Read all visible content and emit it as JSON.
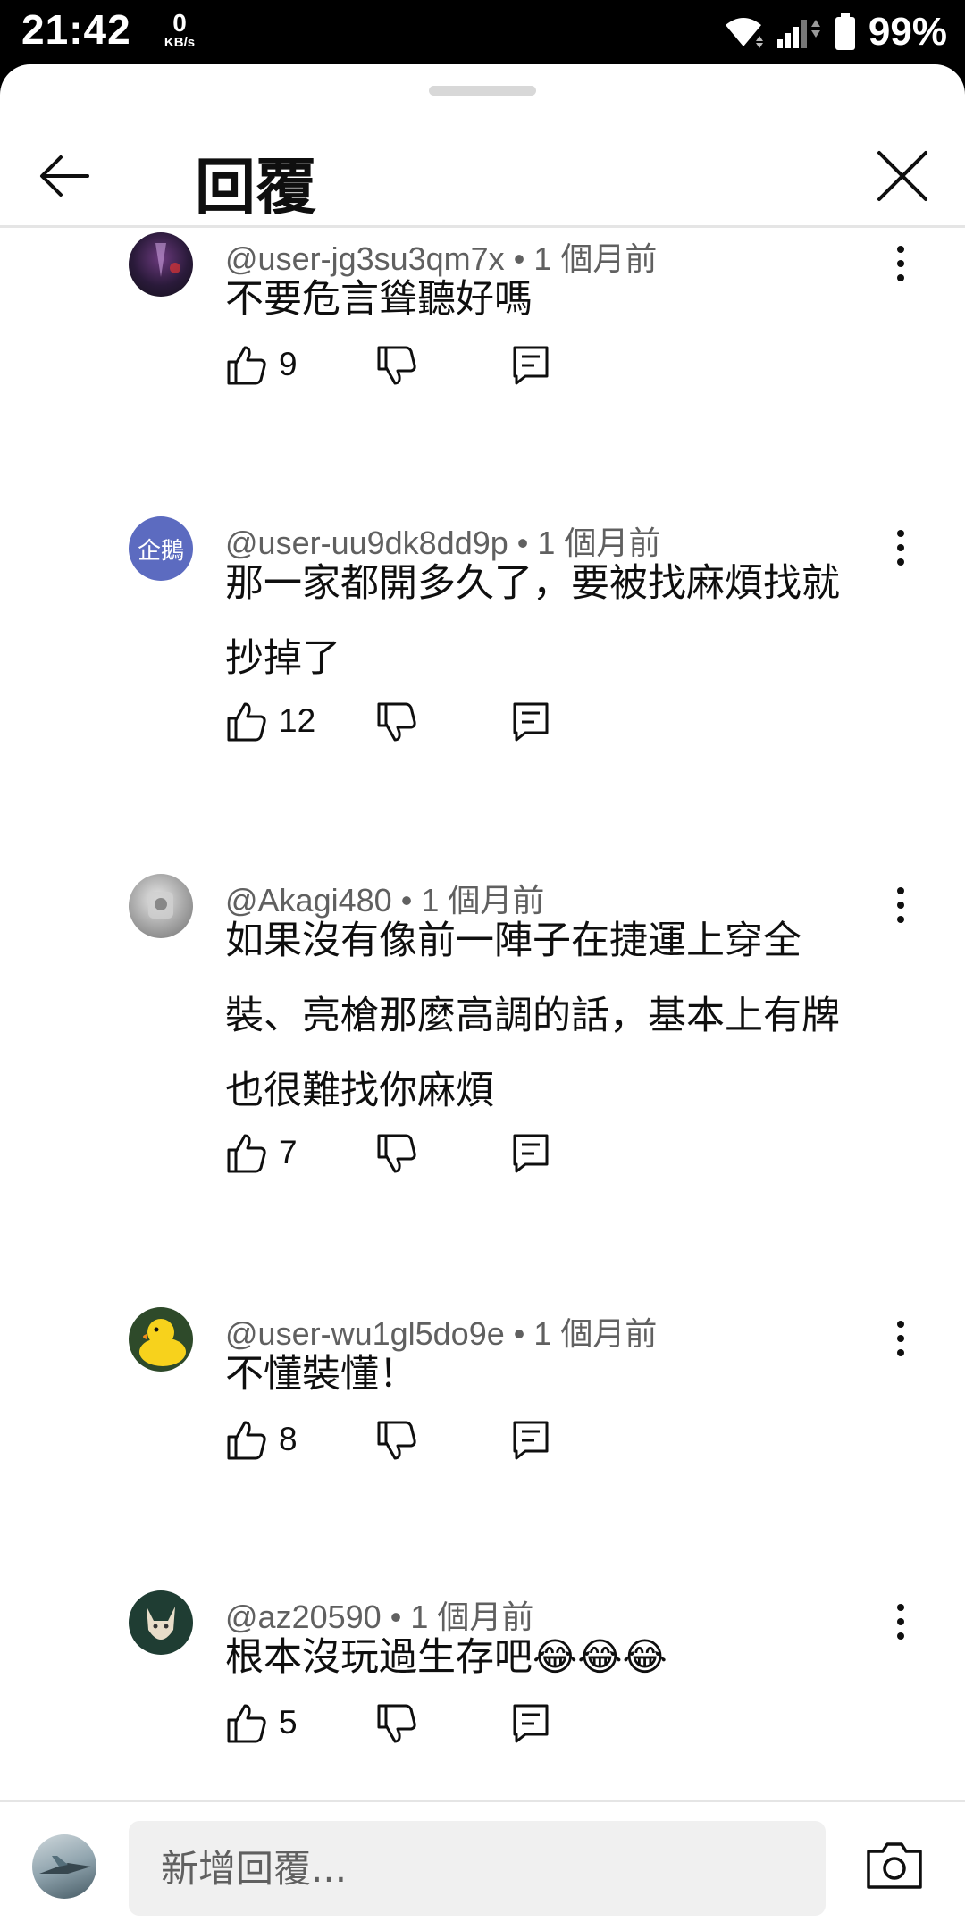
{
  "status_bar": {
    "time": "21:42",
    "net_speed_value": "0",
    "net_speed_unit": "KB/s",
    "battery": "99%"
  },
  "header": {
    "title": "回覆"
  },
  "comments": [
    {
      "author": "@user-jg3su3qm7x",
      "time": "1 個月前",
      "text": "不要危言聳聽好嗎",
      "likes": "9",
      "avatar": "photo-dark"
    },
    {
      "author": "@user-uu9dk8dd9p",
      "time": "1 個月前",
      "text": "那一家都開多久了，要被找麻煩找就抄掉了",
      "likes": "12",
      "avatar_text": "企鵝",
      "avatar_color": "#5c6bc0"
    },
    {
      "author": "@Akagi480",
      "time": "1 個月前",
      "text": "如果沒有像前一陣子在捷運上穿全裝、亮槍那麼高調的話，基本上有牌也很難找你麻煩",
      "likes": "7",
      "avatar": "photo-grey"
    },
    {
      "author": "@user-wu1gl5do9e",
      "time": "1 個月前",
      "text": "不懂裝懂！",
      "likes": "8",
      "avatar": "rubber-duck"
    },
    {
      "author": "@az20590",
      "time": "1 個月前",
      "text": "根本沒玩過生存吧😂😂😂",
      "likes": "5",
      "avatar": "cat-drawing"
    }
  ],
  "footer": {
    "placeholder": "新增回覆...",
    "separator": "•"
  },
  "colors": {
    "text_primary": "#0f0f0f",
    "text_secondary": "#606060",
    "input_bg": "#f0f0f0"
  }
}
